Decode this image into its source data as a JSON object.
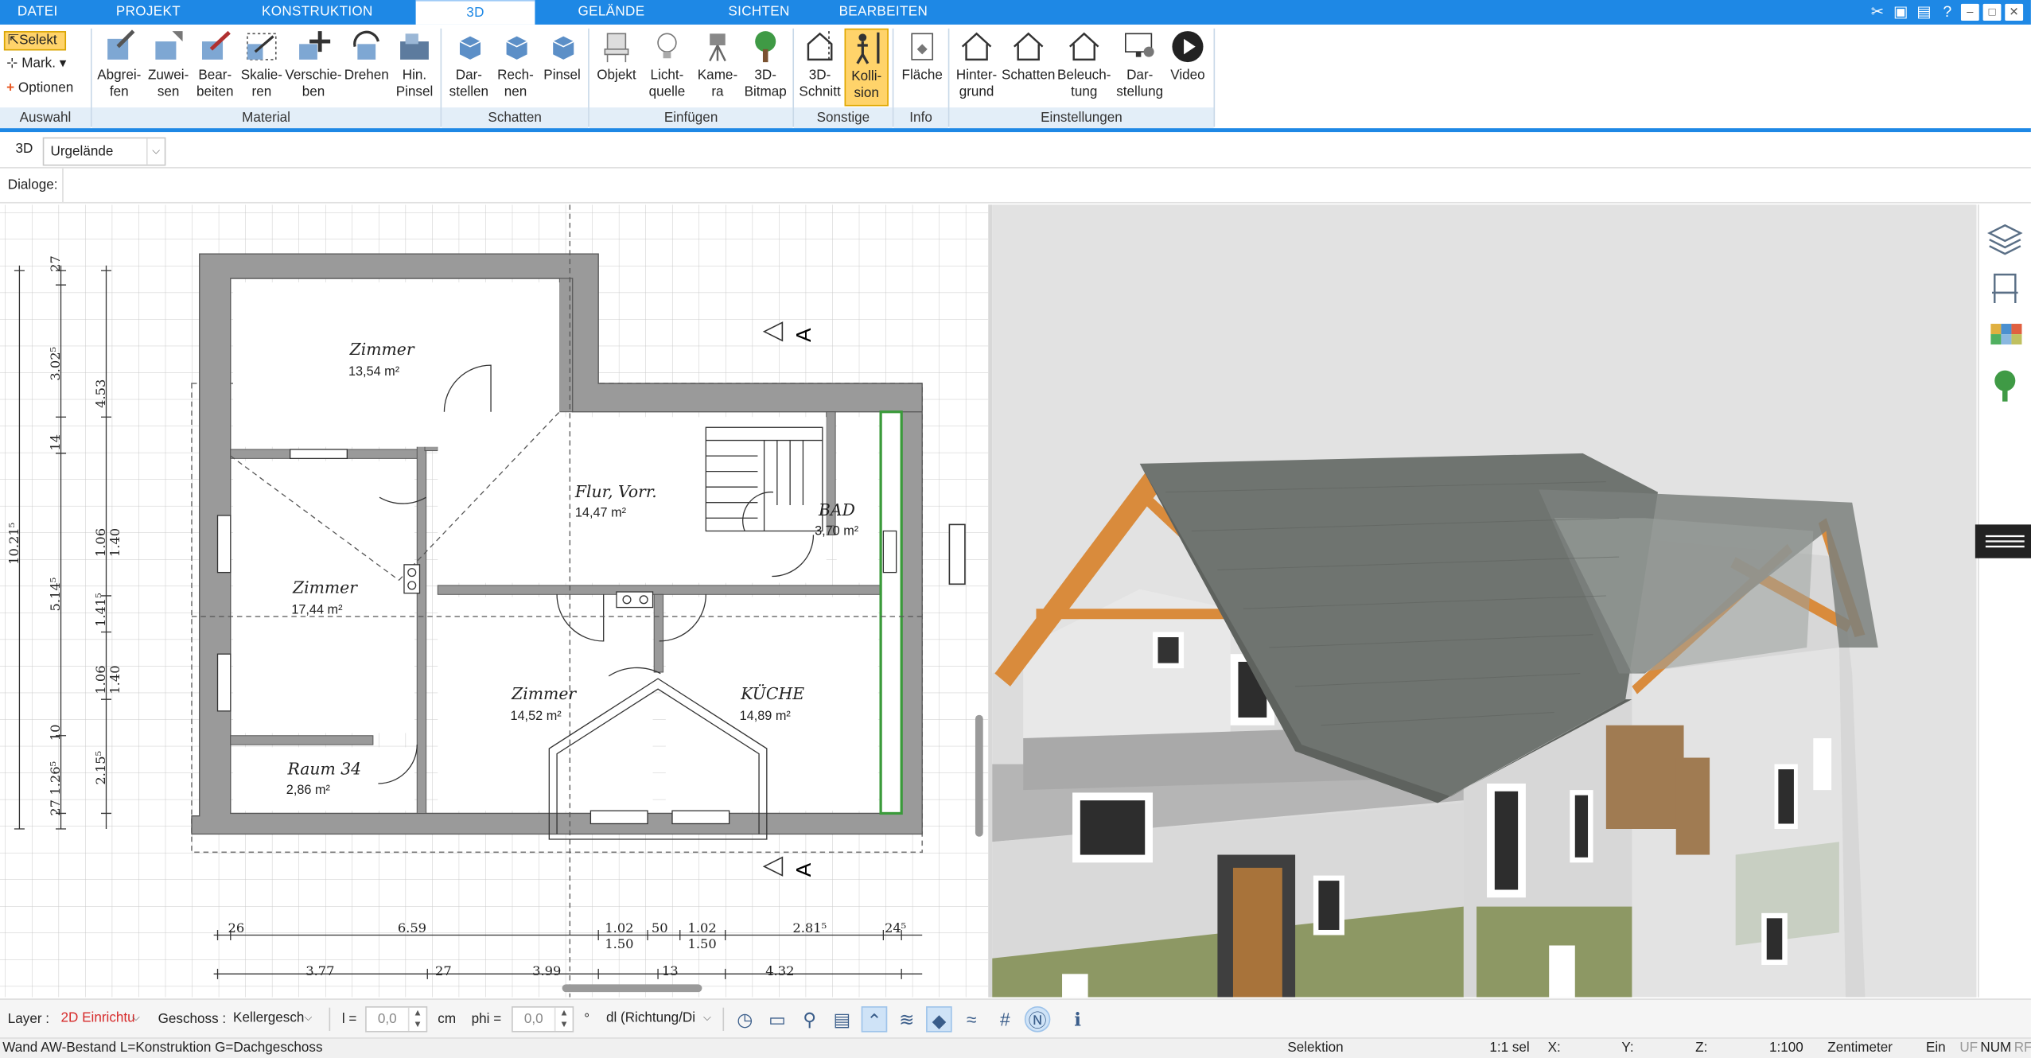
{
  "tabs": [
    "DATEI",
    "PROJEKT",
    "KONSTRUKTION",
    "3D",
    "GELÄNDE",
    "SICHTEN",
    "BEARBEITEN"
  ],
  "active_tab": "3D",
  "auswahl": {
    "select": "Selekt",
    "mark": "Mark.",
    "options": "Optionen",
    "label": "Auswahl"
  },
  "groups": {
    "material": {
      "label": "Material",
      "buttons": [
        "Abgrei-\nfen",
        "Zuwei-\nsen",
        "Bear-\nbeiten",
        "Skalie-\nren",
        "Verschie-\nben",
        "Drehen",
        "Hin.\nPinsel"
      ]
    },
    "schatten": {
      "label": "Schatten",
      "buttons": [
        "Dar-\nstellen",
        "Rech-\nnen",
        "Pinsel"
      ]
    },
    "einfuegen": {
      "label": "Einfügen",
      "buttons": [
        "Objekt",
        "Licht-\nquelle",
        "Kame-\nra",
        "3D-\nBitmap"
      ]
    },
    "sonstige": {
      "label": "Sonstige",
      "buttons": [
        "3D-\nSchnitt",
        "Kolli-\nsion"
      ]
    },
    "info": {
      "label": "Info",
      "buttons": [
        "Fläche"
      ]
    },
    "einstellungen": {
      "label": "Einstellungen",
      "buttons": [
        "Hinter-\ngrund",
        "Schatten",
        "Beleuch-\ntung",
        "Dar-\nstellung",
        "Video"
      ]
    }
  },
  "view_row": {
    "mode": "3D",
    "selected": "Urgelände"
  },
  "dialoge_label": "Dialoge:",
  "plan": {
    "rooms": [
      {
        "name": "Zimmer",
        "area": "13,54 m²"
      },
      {
        "name": "Flur, Vorr.",
        "area": "14,47 m²"
      },
      {
        "name": "BAD",
        "area": "3,70 m²"
      },
      {
        "name": "Zimmer",
        "area": "17,44 m²"
      },
      {
        "name": "Zimmer",
        "area": "14,52 m²"
      },
      {
        "name": "KÜCHE",
        "area": "14,89 m²"
      },
      {
        "name": "Raum 34",
        "area": "2,86 m²"
      }
    ],
    "section_marker": "A",
    "dims_left": [
      "27",
      "3.02⁵",
      "4.53",
      "14",
      "10.21⁵",
      "1.06",
      "1.40",
      "5.14⁵",
      "1.41⁵",
      "1.06",
      "1.40",
      "10",
      "1.26⁵",
      "2.15⁵",
      "27"
    ],
    "dims_bottom_1": [
      "26",
      "6.59",
      "1.02",
      "1.50",
      "50",
      "1.02",
      "1.50",
      "2.81⁵",
      "24⁵"
    ],
    "dims_bottom_2": [
      "3.77",
      "27",
      "3.99",
      "13",
      "4.32"
    ]
  },
  "bottom": {
    "layer_label": "Layer :",
    "layer_value": "2D Einrichtu",
    "geschoss_label": "Geschoss :",
    "geschoss_value": "Kellergesch",
    "l_label": "l =",
    "l_value": "0,0",
    "l_unit": "cm",
    "phi_label": "phi =",
    "phi_value": "0,0",
    "phi_unit": "°",
    "dl_value": "dl (Richtung/Di"
  },
  "status": {
    "message": "Wand AW-Bestand L=Konstruktion G=Dachgeschoss",
    "mode": "Selektion",
    "sel": "1:1 sel",
    "x": "X:",
    "y": "Y:",
    "z": "Z:",
    "scale": "1:100",
    "unit": "Zentimeter",
    "ein": "Ein",
    "uf": "UF",
    "num": "NUM",
    "rf": "RF"
  },
  "colors": {
    "accent": "#1e88e5",
    "active": "#ffd36a",
    "wall": "#8c8c8c",
    "roof": "#6f7470",
    "timber": "#d98b3c"
  }
}
